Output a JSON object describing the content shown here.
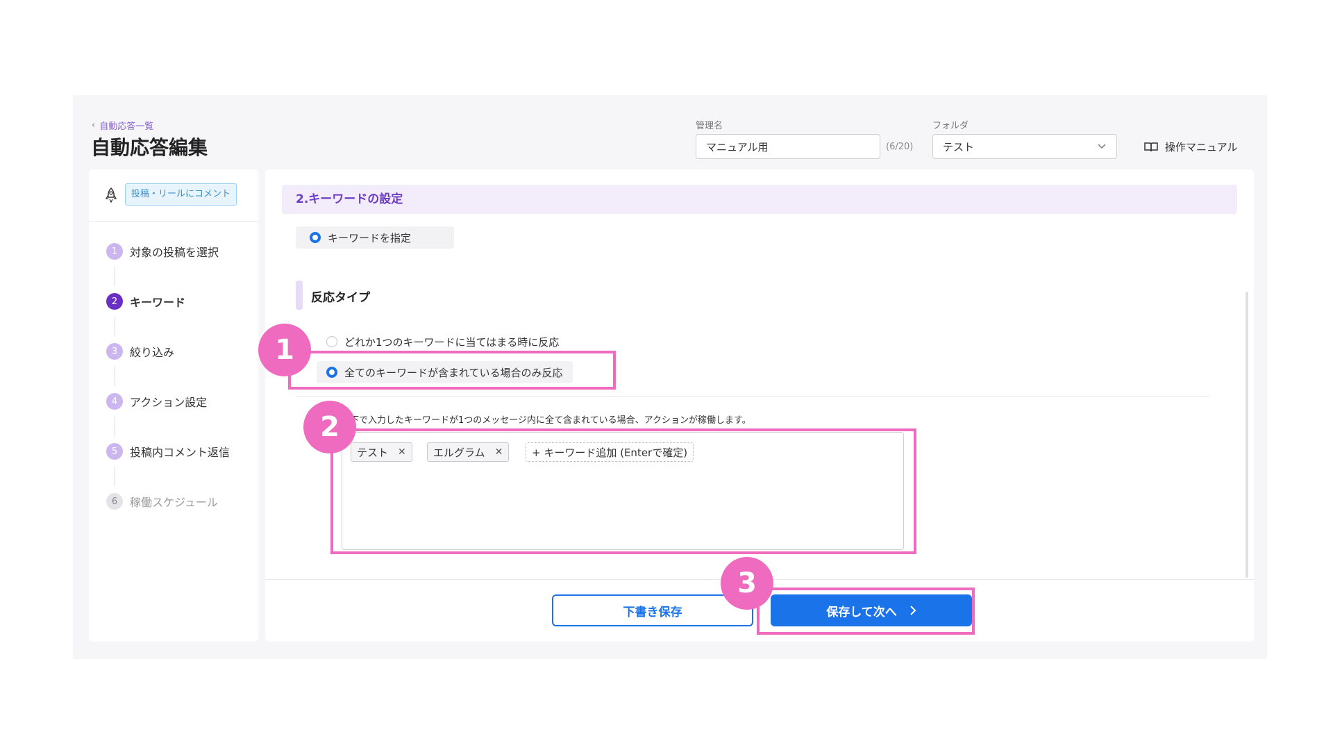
{
  "header": {
    "back_label": "自動応答一覧",
    "title": "自動応答編集",
    "name_label": "管理名",
    "name_value": "マニュアル用",
    "name_count": "(6/20)",
    "folder_label": "フォルダ",
    "folder_value": "テスト",
    "manual_label": "操作マニュアル"
  },
  "sidebar": {
    "trigger_tag": "投稿・リールにコメント",
    "steps": [
      {
        "num": "1",
        "label": "対象の投稿を選択"
      },
      {
        "num": "2",
        "label": "キーワード"
      },
      {
        "num": "3",
        "label": "絞り込み"
      },
      {
        "num": "4",
        "label": "アクション設定"
      },
      {
        "num": "5",
        "label": "投稿内コメント返信"
      },
      {
        "num": "6",
        "label": "稼働スケジュール"
      }
    ]
  },
  "main": {
    "section_title": "2.キーワードの設定",
    "keyword_option": "キーワードを指定",
    "response_type_title": "反応タイプ",
    "response_options": [
      "どれか1つのキーワードに当てはまる時に反応",
      "全てのキーワードが含まれている場合のみ反応"
    ],
    "help_text": "下で入力したキーワードが1つのメッセージ内に全て含まれている場合、アクションが稼働します。",
    "keywords": [
      "テスト",
      "エルグラム"
    ],
    "add_keyword_label": "+ キーワード追加 (Enterで確定)",
    "draft_button": "下書き保存",
    "next_button": "保存して次へ"
  },
  "annotations": [
    "1",
    "2",
    "3"
  ],
  "colors": {
    "accent": "#1a73e8",
    "purple": "#6c2fc6",
    "highlight": "#ee6bbf"
  }
}
